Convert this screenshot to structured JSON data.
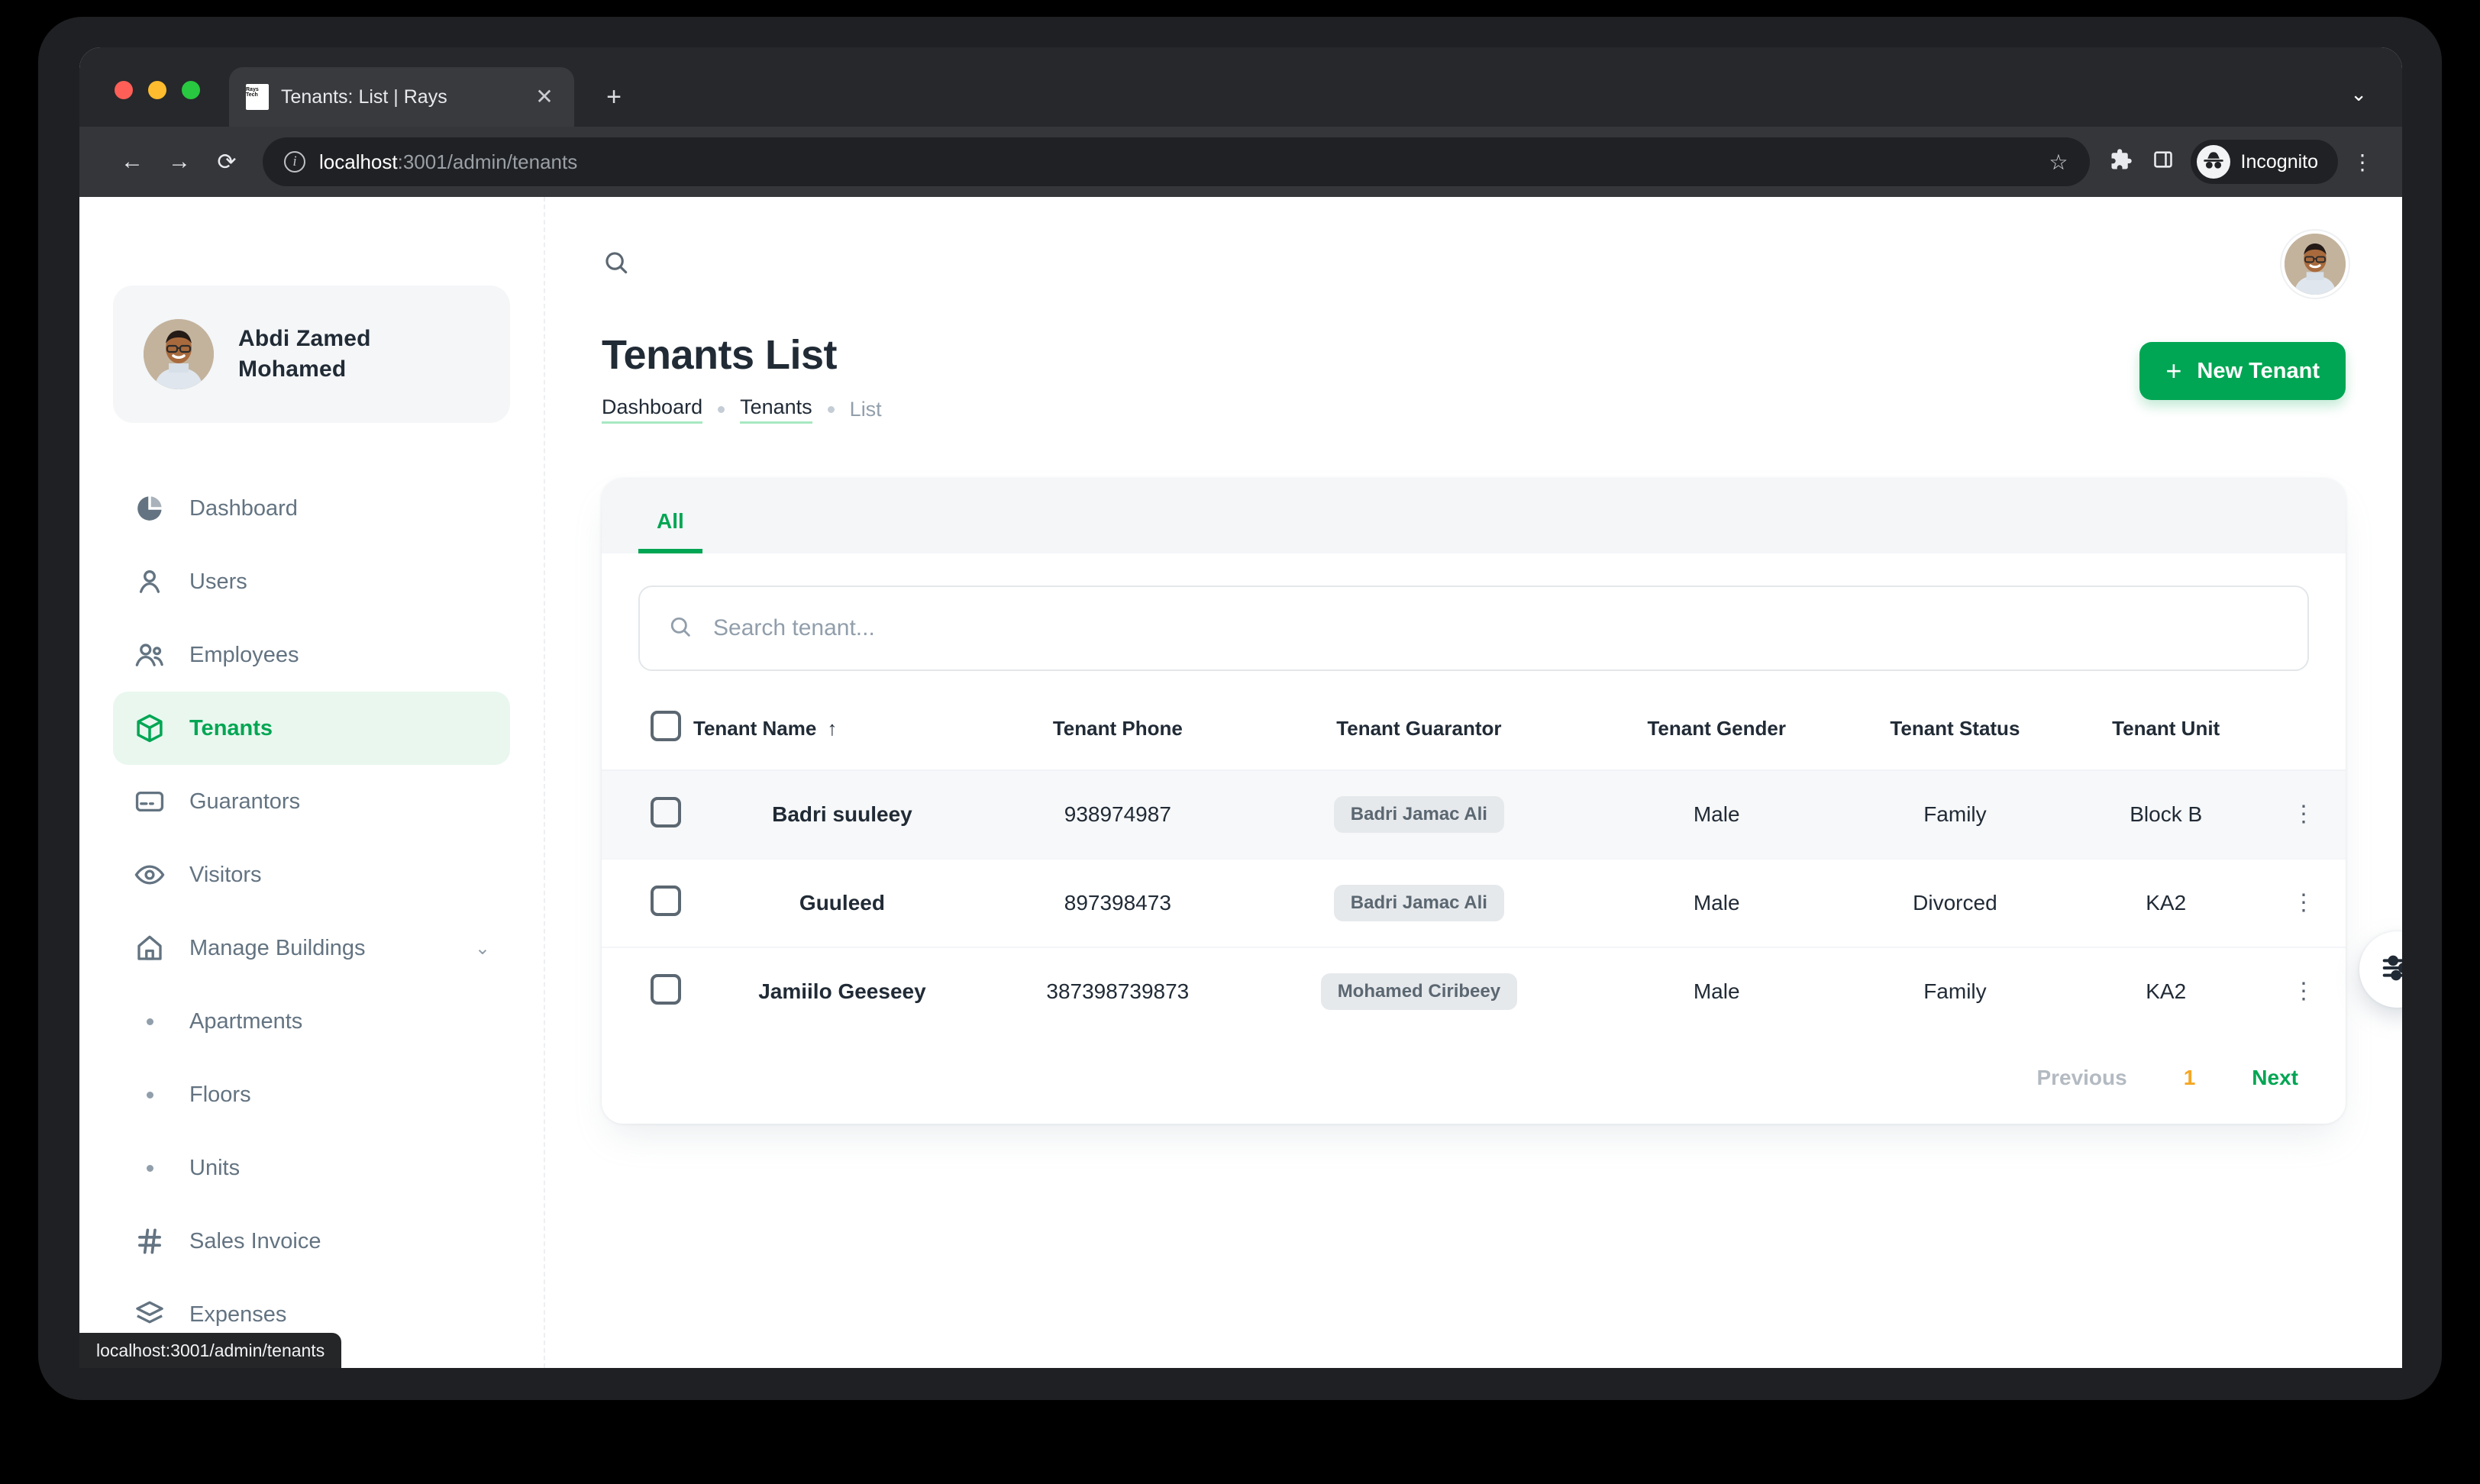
{
  "browser": {
    "tab": {
      "title": "Tenants: List | Rays",
      "favicon_text": "Rays Tech",
      "close_label": "✕"
    },
    "new_tab_label": "+",
    "tabstrip_chevron": "⌄",
    "back_label": "←",
    "forward_label": "→",
    "reload_label": "⟳",
    "url_host": "localhost",
    "url_path": ":3001/admin/tenants",
    "star_label": "☆",
    "profile_label": "Incognito",
    "menu_label": "⋮",
    "status_url": "localhost:3001/admin/tenants"
  },
  "sidebar": {
    "profile": {
      "name_line1": "Abdi Zamed",
      "name_line2": "Mohamed"
    },
    "items": [
      {
        "label": "Dashboard",
        "icon": "pie-chart-icon",
        "active": false,
        "type": "item"
      },
      {
        "label": "Users",
        "icon": "user-icon",
        "active": false,
        "type": "item"
      },
      {
        "label": "Employees",
        "icon": "users-group-icon",
        "active": false,
        "type": "item"
      },
      {
        "label": "Tenants",
        "icon": "box-icon",
        "active": true,
        "type": "item"
      },
      {
        "label": "Guarantors",
        "icon": "credit-card-icon",
        "active": false,
        "type": "item"
      },
      {
        "label": "Visitors",
        "icon": "eye-icon",
        "active": false,
        "type": "item"
      },
      {
        "label": "Manage Buildings",
        "icon": "home-icon",
        "active": false,
        "type": "group",
        "chevron": "⌄"
      },
      {
        "label": "Apartments",
        "icon": "bullet",
        "active": false,
        "type": "sub"
      },
      {
        "label": "Floors",
        "icon": "bullet",
        "active": false,
        "type": "sub"
      },
      {
        "label": "Units",
        "icon": "bullet",
        "active": false,
        "type": "sub"
      },
      {
        "label": "Sales Invoice",
        "icon": "hash-icon",
        "active": false,
        "type": "item"
      },
      {
        "label": "Expenses",
        "icon": "layers-icon",
        "active": false,
        "type": "item"
      }
    ]
  },
  "header": {
    "search_icon": "search-icon",
    "title": "Tenants List",
    "breadcrumbs": [
      {
        "label": "Dashboard",
        "current": false
      },
      {
        "label": "Tenants",
        "current": false
      },
      {
        "label": "List",
        "current": true
      }
    ],
    "new_button": {
      "label": "New Tenant",
      "plus": "+"
    }
  },
  "card": {
    "tabs": [
      {
        "label": "All",
        "active": true
      }
    ],
    "search": {
      "placeholder": "Search tenant...",
      "value": ""
    },
    "table": {
      "columns": [
        "Tenant Name",
        "Tenant Phone",
        "Tenant Guarantor",
        "Tenant Gender",
        "Tenant Status",
        "Tenant Unit"
      ],
      "sort_column": "Tenant Name",
      "sort_arrow": "↑",
      "rows": [
        {
          "name": "Badri suuleey",
          "phone": "938974987",
          "guarantor": "Badri Jamac Ali",
          "gender": "Male",
          "status": "Family",
          "unit": "Block B",
          "hovered": true
        },
        {
          "name": "Guuleed",
          "phone": "897398473",
          "guarantor": "Badri Jamac Ali",
          "gender": "Male",
          "status": "Divorced",
          "unit": "KA2",
          "hovered": false
        },
        {
          "name": "Jamiilo Geeseey",
          "phone": "387398739873",
          "guarantor": "Mohamed Ciribeey",
          "gender": "Male",
          "status": "Family",
          "unit": "KA2",
          "hovered": false
        }
      ]
    },
    "pagination": {
      "previous": "Previous",
      "page": "1",
      "next": "Next"
    }
  },
  "fab": {
    "icon": "settings-sliders-icon"
  },
  "colors": {
    "accent_green": "#00a653",
    "accent_green_soft": "#e9f7ef",
    "page_number": "#f5a623",
    "text_primary": "#212b36",
    "text_secondary": "#637381",
    "chip_bg": "#e6e9ec"
  }
}
